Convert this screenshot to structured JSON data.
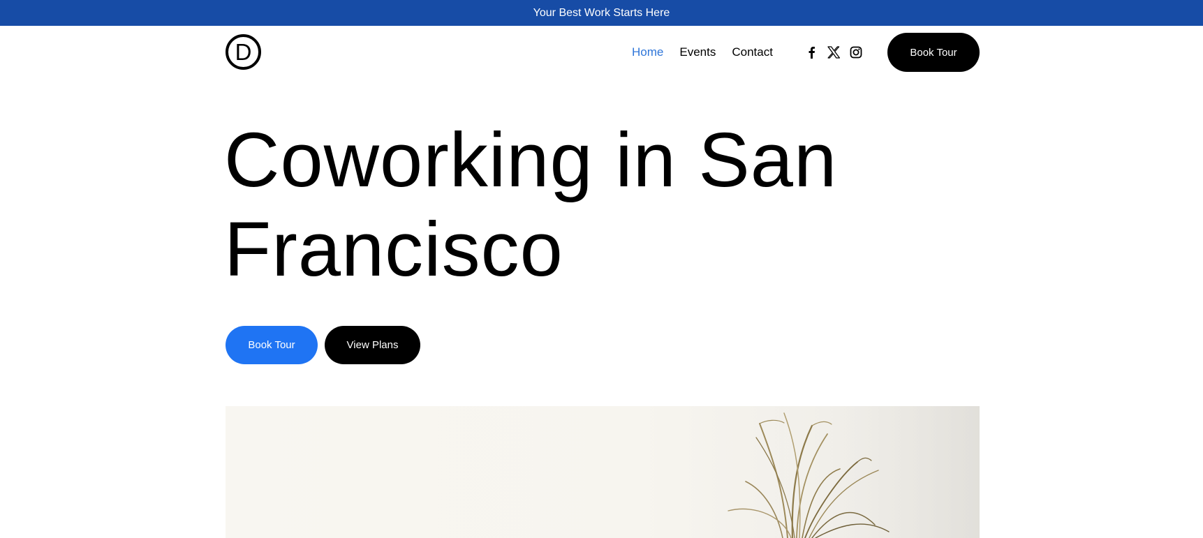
{
  "announcement": {
    "text": "Your Best Work Starts Here"
  },
  "header": {
    "logo_letter": "D",
    "nav": [
      {
        "label": "Home",
        "active": true
      },
      {
        "label": "Events",
        "active": false
      },
      {
        "label": "Contact",
        "active": false
      }
    ],
    "socials": [
      "facebook-icon",
      "x-icon",
      "instagram-icon"
    ],
    "cta_label": "Book Tour"
  },
  "hero": {
    "title_line1": "Coworking in San",
    "title_line2": "Francisco",
    "primary_button": "Book Tour",
    "secondary_button": "View Plans"
  },
  "colors": {
    "announcement_bg": "#174ca6",
    "accent_blue": "#1f74f3",
    "active_link": "#2f76d9",
    "dark": "#000000"
  }
}
